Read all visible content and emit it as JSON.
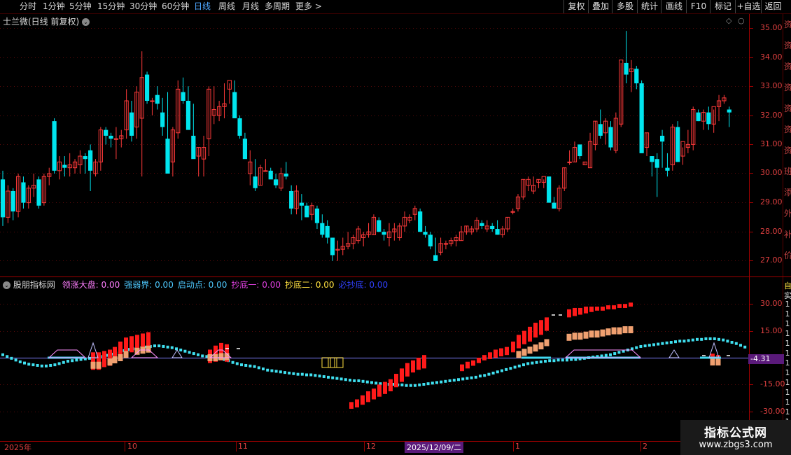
{
  "toolbar": {
    "periods": [
      "分时",
      "1分钟",
      "5分钟",
      "15分钟",
      "30分钟",
      "60分钟",
      "日线",
      "周线",
      "月线",
      "多周期",
      "更多 >"
    ],
    "active_period": "日线",
    "right_buttons": [
      "复权",
      "叠加",
      "多股",
      "统计",
      "画线",
      "F10",
      "标记",
      "+自选",
      "返回"
    ]
  },
  "main_panel": {
    "title": "士兰微(日线 前复权)",
    "y_labels": [
      "35.00",
      "34.00",
      "33.00",
      "32.00",
      "31.00",
      "30.00",
      "29.00",
      "28.00",
      "27.00"
    ]
  },
  "indicator_panel": {
    "name": "股朋指标网",
    "legend": [
      {
        "text": "领涨大盘: 0.00",
        "color": "#ff7fff"
      },
      {
        "text": "强弱界: 0.00",
        "color": "#4ec9ff"
      },
      {
        "text": "启动点: 0.00",
        "color": "#4ec9ff"
      },
      {
        "text": "抄底一: 0.00",
        "color": "#e040e0"
      },
      {
        "text": "抄底二: 0.00",
        "color": "#ffe040"
      },
      {
        "text": "必抄底: 0.00",
        "color": "#3040ff"
      }
    ],
    "y_labels": [
      "30.00",
      "15.00",
      "-15.00",
      "-30.00"
    ],
    "current_value": "-4.31"
  },
  "x_axis": {
    "labels": [
      "2025年",
      "10",
      "11",
      "12",
      "2025/12/09/二",
      "1",
      "2"
    ]
  },
  "right_strip": {
    "top_glyphs": [
      "资",
      "资",
      "资",
      "资",
      "资",
      "资",
      "资",
      "班",
      "添",
      "外",
      "补",
      "价"
    ],
    "bottom_glyphs": [
      "自",
      "实",
      "1",
      "1",
      "1",
      "1",
      "1",
      "1",
      "1",
      "1",
      "1",
      "1",
      "1",
      "1",
      "1"
    ]
  },
  "watermark": {
    "line1": "指标公式网",
    "line2": "www.zbgs3.com"
  },
  "colors": {
    "up": "#ff3a3a",
    "down": "#00e5ee",
    "axis": "#a00000",
    "selected_date_bg": "#5a1a7a",
    "value_bg": "#5a1a7a"
  }
}
